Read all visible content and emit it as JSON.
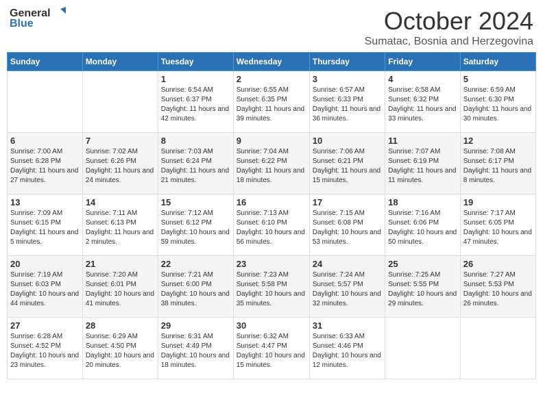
{
  "header": {
    "logo_line1": "General",
    "logo_line2": "Blue",
    "month": "October 2024",
    "location": "Sumatac, Bosnia and Herzegovina"
  },
  "weekdays": [
    "Sunday",
    "Monday",
    "Tuesday",
    "Wednesday",
    "Thursday",
    "Friday",
    "Saturday"
  ],
  "weeks": [
    [
      {
        "day": "",
        "info": ""
      },
      {
        "day": "",
        "info": ""
      },
      {
        "day": "1",
        "info": "Sunrise: 6:54 AM\nSunset: 6:37 PM\nDaylight: 11 hours and 42 minutes."
      },
      {
        "day": "2",
        "info": "Sunrise: 6:55 AM\nSunset: 6:35 PM\nDaylight: 11 hours and 39 minutes."
      },
      {
        "day": "3",
        "info": "Sunrise: 6:57 AM\nSunset: 6:33 PM\nDaylight: 11 hours and 36 minutes."
      },
      {
        "day": "4",
        "info": "Sunrise: 6:58 AM\nSunset: 6:32 PM\nDaylight: 11 hours and 33 minutes."
      },
      {
        "day": "5",
        "info": "Sunrise: 6:59 AM\nSunset: 6:30 PM\nDaylight: 11 hours and 30 minutes."
      }
    ],
    [
      {
        "day": "6",
        "info": "Sunrise: 7:00 AM\nSunset: 6:28 PM\nDaylight: 11 hours and 27 minutes."
      },
      {
        "day": "7",
        "info": "Sunrise: 7:02 AM\nSunset: 6:26 PM\nDaylight: 11 hours and 24 minutes."
      },
      {
        "day": "8",
        "info": "Sunrise: 7:03 AM\nSunset: 6:24 PM\nDaylight: 11 hours and 21 minutes."
      },
      {
        "day": "9",
        "info": "Sunrise: 7:04 AM\nSunset: 6:22 PM\nDaylight: 11 hours and 18 minutes."
      },
      {
        "day": "10",
        "info": "Sunrise: 7:06 AM\nSunset: 6:21 PM\nDaylight: 11 hours and 15 minutes."
      },
      {
        "day": "11",
        "info": "Sunrise: 7:07 AM\nSunset: 6:19 PM\nDaylight: 11 hours and 11 minutes."
      },
      {
        "day": "12",
        "info": "Sunrise: 7:08 AM\nSunset: 6:17 PM\nDaylight: 11 hours and 8 minutes."
      }
    ],
    [
      {
        "day": "13",
        "info": "Sunrise: 7:09 AM\nSunset: 6:15 PM\nDaylight: 11 hours and 5 minutes."
      },
      {
        "day": "14",
        "info": "Sunrise: 7:11 AM\nSunset: 6:13 PM\nDaylight: 11 hours and 2 minutes."
      },
      {
        "day": "15",
        "info": "Sunrise: 7:12 AM\nSunset: 6:12 PM\nDaylight: 10 hours and 59 minutes."
      },
      {
        "day": "16",
        "info": "Sunrise: 7:13 AM\nSunset: 6:10 PM\nDaylight: 10 hours and 56 minutes."
      },
      {
        "day": "17",
        "info": "Sunrise: 7:15 AM\nSunset: 6:08 PM\nDaylight: 10 hours and 53 minutes."
      },
      {
        "day": "18",
        "info": "Sunrise: 7:16 AM\nSunset: 6:06 PM\nDaylight: 10 hours and 50 minutes."
      },
      {
        "day": "19",
        "info": "Sunrise: 7:17 AM\nSunset: 6:05 PM\nDaylight: 10 hours and 47 minutes."
      }
    ],
    [
      {
        "day": "20",
        "info": "Sunrise: 7:19 AM\nSunset: 6:03 PM\nDaylight: 10 hours and 44 minutes."
      },
      {
        "day": "21",
        "info": "Sunrise: 7:20 AM\nSunset: 6:01 PM\nDaylight: 10 hours and 41 minutes."
      },
      {
        "day": "22",
        "info": "Sunrise: 7:21 AM\nSunset: 6:00 PM\nDaylight: 10 hours and 38 minutes."
      },
      {
        "day": "23",
        "info": "Sunrise: 7:23 AM\nSunset: 5:58 PM\nDaylight: 10 hours and 35 minutes."
      },
      {
        "day": "24",
        "info": "Sunrise: 7:24 AM\nSunset: 5:57 PM\nDaylight: 10 hours and 32 minutes."
      },
      {
        "day": "25",
        "info": "Sunrise: 7:25 AM\nSunset: 5:55 PM\nDaylight: 10 hours and 29 minutes."
      },
      {
        "day": "26",
        "info": "Sunrise: 7:27 AM\nSunset: 5:53 PM\nDaylight: 10 hours and 26 minutes."
      }
    ],
    [
      {
        "day": "27",
        "info": "Sunrise: 6:28 AM\nSunset: 4:52 PM\nDaylight: 10 hours and 23 minutes."
      },
      {
        "day": "28",
        "info": "Sunrise: 6:29 AM\nSunset: 4:50 PM\nDaylight: 10 hours and 20 minutes."
      },
      {
        "day": "29",
        "info": "Sunrise: 6:31 AM\nSunset: 4:49 PM\nDaylight: 10 hours and 18 minutes."
      },
      {
        "day": "30",
        "info": "Sunrise: 6:32 AM\nSunset: 4:47 PM\nDaylight: 10 hours and 15 minutes."
      },
      {
        "day": "31",
        "info": "Sunrise: 6:33 AM\nSunset: 4:46 PM\nDaylight: 10 hours and 12 minutes."
      },
      {
        "day": "",
        "info": ""
      },
      {
        "day": "",
        "info": ""
      }
    ]
  ]
}
